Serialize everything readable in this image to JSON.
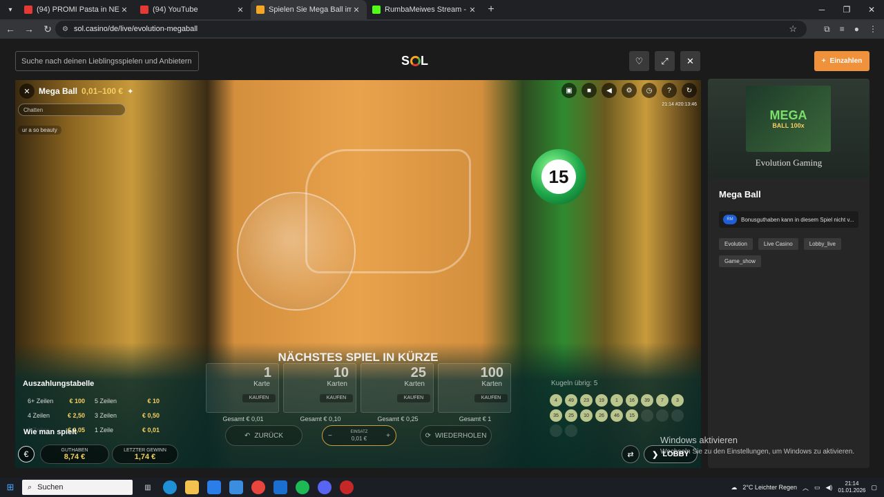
{
  "browser": {
    "tabs": [
      {
        "title": "(94) PROMI Pasta in NEW YORK",
        "fav": "#e53935"
      },
      {
        "title": "(94) YouTube",
        "fav": "#e53935"
      },
      {
        "title": "Spielen Sie Mega Ball im Sol",
        "fav": "#f5a623"
      },
      {
        "title": "RumbaMeiwes Stream - Watch",
        "fav": "#53fc18"
      }
    ],
    "url": "sol.casino/de/live/evolution-megaball"
  },
  "site": {
    "search_placeholder": "Suche nach deinen Lieblingsspielen und Anbietern",
    "logo_left": "S",
    "logo_right": "L",
    "deposit_label": "Einzahlen"
  },
  "game": {
    "title": "Mega Ball",
    "limits": "0,01–100 €",
    "chat_placeholder": "Chatten",
    "chat_message": "ur a so beauty",
    "time": "21:14  #20:13:46",
    "ball_number": "15",
    "status": "NÄCHSTES SPIEL IN KÜRZE",
    "cards": [
      {
        "n": "1",
        "label": "Karte",
        "buy": "KAUFEN",
        "total": "Gesamt € 0,01"
      },
      {
        "n": "10",
        "label": "Karten",
        "buy": "KAUFEN",
        "total": "Gesamt € 0,10"
      },
      {
        "n": "25",
        "label": "Karten",
        "buy": "KAUFEN",
        "total": "Gesamt € 0,25"
      },
      {
        "n": "100",
        "label": "Karten",
        "buy": "KAUFEN",
        "total": "Gesamt € 1"
      }
    ],
    "balls_left": "Kugeln übrig: 5",
    "balls": [
      "4",
      "49",
      "23",
      "19",
      "1",
      "16",
      "39",
      "7",
      "3",
      "35",
      "25",
      "10",
      "26",
      "46",
      "15"
    ],
    "paytable_title": "Auszahlungstabelle",
    "paytable": [
      {
        "l1": "6+ Zeilen",
        "v1": "€ 100",
        "l2": "5 Zeilen",
        "v2": "€ 10"
      },
      {
        "l1": "4 Zeilen",
        "v1": "€ 2,50",
        "l2": "3 Zeilen",
        "v2": "€ 0,50"
      },
      {
        "l1": "2 Zeilen",
        "v1": "€ 0,05",
        "l2": "1 Zeile",
        "v2": "€ 0,01"
      }
    ],
    "howto": "Wie man spielt",
    "back": "ZURÜCK",
    "stake_label": "EINSATZ",
    "stake_value": "0,01 €",
    "repeat": "WIEDERHOLEN",
    "balance_label": "GUTHABEN",
    "balance": "8,74 €",
    "lastwin_label": "LETZTER GEWINN",
    "lastwin": "1,74 €",
    "lobby": "LOBBY"
  },
  "sidebar": {
    "thumb_line1": "MEGA",
    "thumb_line2": "BALL 100x",
    "provider": "Evolution Gaming",
    "name": "Mega Ball",
    "notice_icon": "RM",
    "notice": "Bonusguthaben kann in diesem Spiel nicht v...",
    "tags": [
      "Evolution",
      "Live Casino",
      "Lobby_live",
      "Game_show"
    ]
  },
  "windows": {
    "activate": "Windows aktivieren",
    "activate_sub": "Wechseln Sie zu den Einstellungen, um Windows zu aktivieren.",
    "search": "Suchen",
    "weather": "2°C  Leichter Regen",
    "time": "21:14",
    "date": "01.01.2026"
  }
}
